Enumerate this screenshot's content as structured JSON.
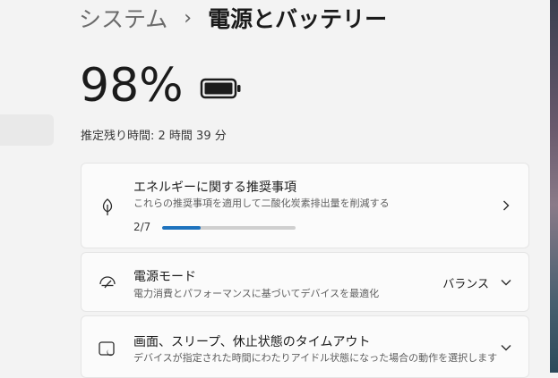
{
  "breadcrumb": {
    "parent": "システム",
    "separator": "›",
    "current": "電源とバッテリー"
  },
  "battery": {
    "percent": "98%",
    "remaining": "推定残り時間: 2 時間 39 分"
  },
  "cards": {
    "energy": {
      "icon": "leaf-icon",
      "title": "エネルギーに関する推奨事項",
      "description": "これらの推奨事項を適用して二酸化炭素排出量を削減する",
      "progress_text": "2/7",
      "progress_fraction": 0.2857
    },
    "power_mode": {
      "icon": "power-mode-icon",
      "title": "電源モード",
      "description": "電力消費とパフォーマンスに基づいてデバイスを最適化",
      "value": "バランス"
    },
    "screen_sleep": {
      "icon": "screen-sleep-icon",
      "title": "画面、スリープ、休止状態のタイムアウト",
      "description": "デバイスが指定された時間にわたりアイドル状態になった場合の動作を選択します"
    }
  },
  "colors": {
    "accent": "#1e73be",
    "background": "#f3f3f3",
    "card": "#fbfbfb"
  }
}
